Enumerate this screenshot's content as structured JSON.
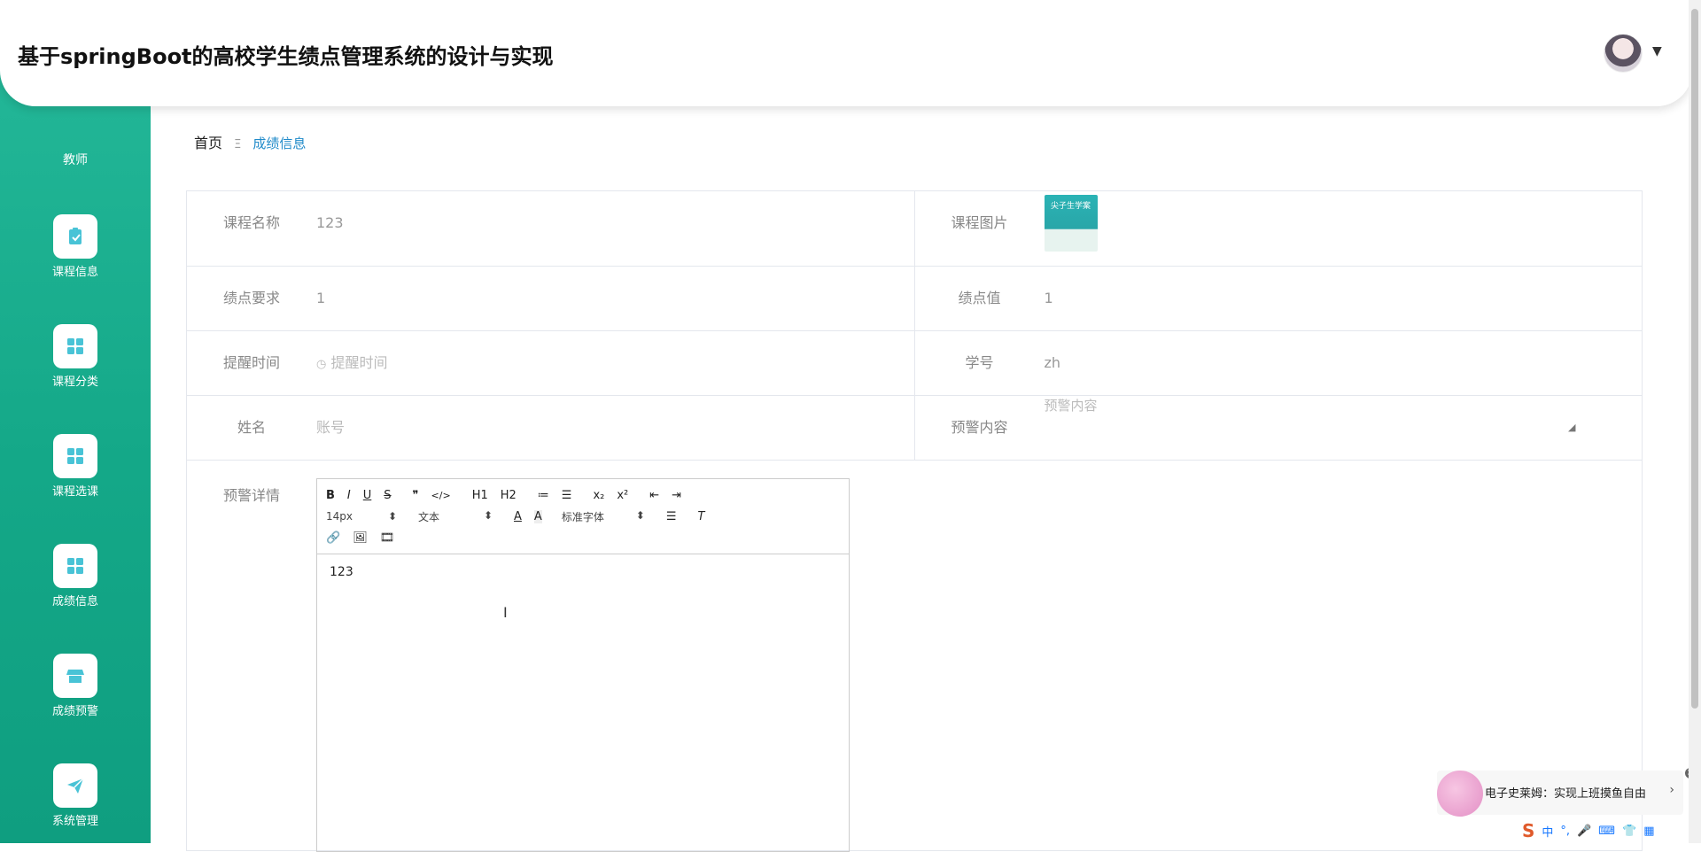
{
  "header": {
    "title": "基于springBoot的高校学生绩点管理系统的设计与实现"
  },
  "sidebar": {
    "role": "教师",
    "items": [
      {
        "label": "课程信息",
        "icon": "clipboard-check-icon"
      },
      {
        "label": "课程分类",
        "icon": "grid-icon"
      },
      {
        "label": "课程选课",
        "icon": "grid-icon"
      },
      {
        "label": "成绩信息",
        "icon": "grid-icon"
      },
      {
        "label": "成绩预警",
        "icon": "store-icon"
      },
      {
        "label": "系统管理",
        "icon": "paper-plane-icon"
      }
    ]
  },
  "breadcrumb": {
    "home": "首页",
    "separator": "Ξ",
    "current": "成绩信息"
  },
  "form": {
    "course_name": {
      "label": "课程名称",
      "value": "123"
    },
    "course_image": {
      "label": "课程图片",
      "image_text": "尖子生学案"
    },
    "gpa_requirement": {
      "label": "绩点要求",
      "value": "1"
    },
    "gpa_value": {
      "label": "绩点值",
      "value": "1"
    },
    "reminder_time": {
      "label": "提醒时间",
      "placeholder": "提醒时间"
    },
    "student_id": {
      "label": "学号",
      "value": "zh"
    },
    "name": {
      "label": "姓名",
      "placeholder": "账号"
    },
    "warning_content": {
      "label": "预警内容",
      "placeholder": "预警内容"
    },
    "warning_detail": {
      "label": "预警详情"
    }
  },
  "editor": {
    "toolbar_row1": [
      "B",
      "I",
      "U",
      "S",
      "❞",
      "</>",
      "H1",
      "H2",
      "≔",
      "☰",
      "x₂",
      "x²",
      "⇤",
      "⇥"
    ],
    "font_size": "14px",
    "text_style": "文本",
    "font_family": "标准字体",
    "content": "123"
  },
  "popup": {
    "text": "电子史莱姆：实现上班摸鱼自由"
  },
  "ime": {
    "items": [
      "中",
      "°,",
      "🎤",
      "⌨",
      "👕",
      "▦"
    ]
  },
  "colors": {
    "sidebar": "#1aae8f",
    "link": "#1f8ac9"
  }
}
